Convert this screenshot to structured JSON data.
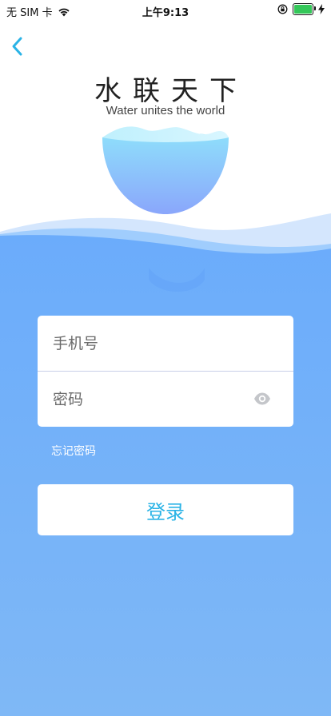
{
  "status_bar": {
    "carrier": "无 SIM 卡",
    "time": "上午9:13"
  },
  "logo": {
    "title": "水联天下",
    "subtitle": "Water unites the world"
  },
  "form": {
    "phone_placeholder": "手机号",
    "password_placeholder": "密码",
    "forgot_password": "忘记密码",
    "login_label": "登录"
  },
  "icons": {
    "back": "chevron-left-icon",
    "password_visibility": "eye-icon",
    "wifi": "wifi-icon",
    "orientation_lock": "orientation-lock-icon",
    "battery": "battery-icon",
    "charging": "charging-bolt-icon"
  },
  "colors": {
    "accent": "#2ab3e6",
    "background_top": "#6fb0fb",
    "background_bottom": "#7db6f7",
    "battery": "#34c759"
  }
}
